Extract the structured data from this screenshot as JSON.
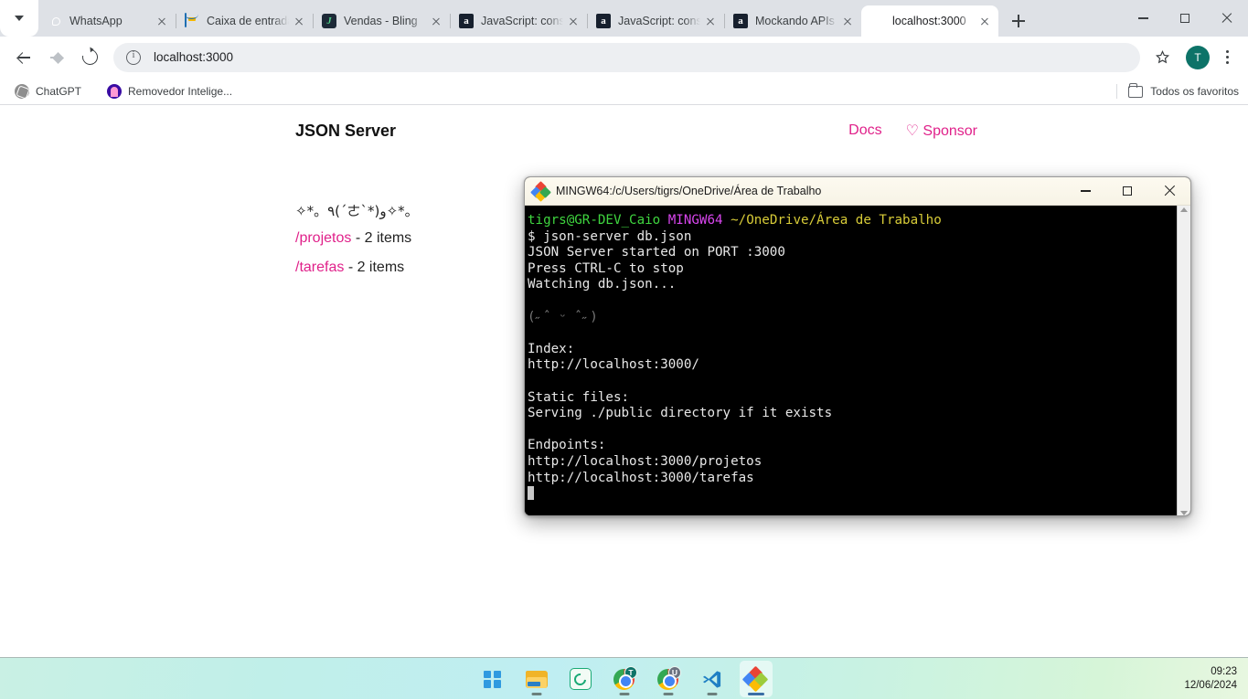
{
  "browser": {
    "tabs": [
      {
        "title": "WhatsApp",
        "icon": "whatsapp-icon",
        "active": false
      },
      {
        "title": "Caixa de entrada",
        "icon": "mail-icon",
        "active": false
      },
      {
        "title": "Vendas - Bling",
        "icon": "bling-icon",
        "active": false
      },
      {
        "title": "JavaScript: consu",
        "icon": "alura-icon",
        "active": false
      },
      {
        "title": "JavaScript: consu",
        "icon": "alura-icon",
        "active": false
      },
      {
        "title": "Mockando APIs",
        "icon": "alura-icon",
        "active": false
      },
      {
        "title": "localhost:3000",
        "icon": "globe-icon",
        "active": true
      }
    ],
    "new_tab_label": "+",
    "url": "localhost:3000",
    "profile_initial": "T",
    "bookmarks": [
      {
        "label": "ChatGPT",
        "icon": "chatgpt-icon"
      },
      {
        "label": "Removedor Intelige...",
        "icon": "removedor-icon"
      }
    ],
    "all_bookmarks_label": "Todos os favoritos"
  },
  "page": {
    "title": "JSON Server",
    "links": [
      {
        "label": "Docs"
      },
      {
        "label": "♡ Sponsor"
      }
    ],
    "kaomoji": "✧*。٩(ˊㄜˋ*)و✧*。",
    "resources": [
      {
        "path": "/projetos",
        "count": "- 2 items"
      },
      {
        "path": "/tarefas",
        "count": "- 2 items"
      }
    ]
  },
  "terminal": {
    "window_title": "MINGW64:/c/Users/tigrs/OneDrive/Área de Trabalho",
    "prompt_user": "tigrs@GR-DEV_Caio",
    "prompt_shell": "MINGW64",
    "prompt_path": "~/OneDrive/Área de Trabalho",
    "command": "$ json-server db.json",
    "lines": [
      "JSON Server started on PORT :3000",
      "Press CTRL-C to stop",
      "Watching db.json...",
      "",
      "(˶ˆ ᵕ ˆ˶)",
      "",
      "Index:",
      "http://localhost:3000/",
      "",
      "Static files:",
      "Serving ./public directory if it exists",
      "",
      "Endpoints:",
      "http://localhost:3000/projetos",
      "http://localhost:3000/tarefas"
    ]
  },
  "taskbar": {
    "apps": [
      {
        "name": "start-button"
      },
      {
        "name": "file-explorer"
      },
      {
        "name": "photopea"
      },
      {
        "name": "chrome-profile-t",
        "badge": "T"
      },
      {
        "name": "chrome-profile-u",
        "badge": "U"
      },
      {
        "name": "vscode"
      },
      {
        "name": "git-bash",
        "active": true
      }
    ],
    "time": "09:23",
    "date": "12/06/2024"
  },
  "colors": {
    "accent_pink": "#e0218a",
    "tabstrip_bg": "#dee1e6",
    "terminal_bg": "#000000",
    "prompt_green": "#3fd63f",
    "prompt_purple": "#d946ef",
    "prompt_yellow": "#d8cc38"
  }
}
